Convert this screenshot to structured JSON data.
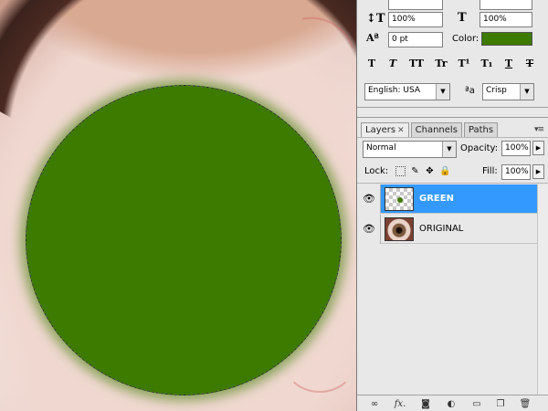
{
  "character": {
    "vscale": "100%",
    "hscale": "100%",
    "baseline": "0 pt",
    "color_label": "Color:",
    "color_value": "#3d7a00",
    "style_buttons": [
      "T",
      "T",
      "TT",
      "Tr",
      "T¹",
      "T₁",
      "T",
      "T"
    ],
    "language": "English: USA",
    "aa_label": "ªa",
    "antialias": "Crisp"
  },
  "layers_panel": {
    "tabs": [
      "Layers",
      "Channels",
      "Paths"
    ],
    "blend_mode": "Normal",
    "opacity_label": "Opacity:",
    "opacity_value": "100%",
    "lock_label": "Lock:",
    "fill_label": "Fill:",
    "fill_value": "100%",
    "layers": [
      {
        "name": "GREEN",
        "selected": true,
        "visible": true
      },
      {
        "name": "ORIGINAL",
        "selected": false,
        "visible": true
      }
    ],
    "footer_buttons": [
      "link-layers-icon",
      "fx-icon",
      "mask-icon",
      "adjustment-icon",
      "group-folder-icon",
      "new-layer-icon",
      "trash-icon"
    ]
  }
}
